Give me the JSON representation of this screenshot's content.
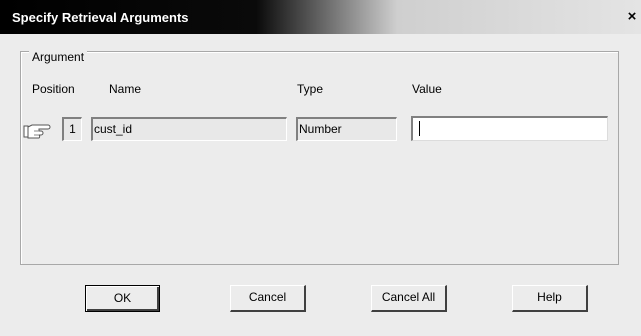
{
  "window": {
    "title": "Specify Retrieval Arguments",
    "close_label": "×"
  },
  "argument_group": {
    "legend": "Argument",
    "columns": {
      "position": "Position",
      "name": "Name",
      "type": "Type",
      "value": "Value"
    },
    "rows": [
      {
        "position": "1",
        "name": "cust_id",
        "type": "Number",
        "value": ""
      }
    ]
  },
  "buttons": {
    "ok": "OK",
    "cancel": "Cancel",
    "cancel_all": "Cancel All",
    "help": "Help"
  },
  "icons": {
    "row_pointer": "pointing-hand-icon"
  }
}
